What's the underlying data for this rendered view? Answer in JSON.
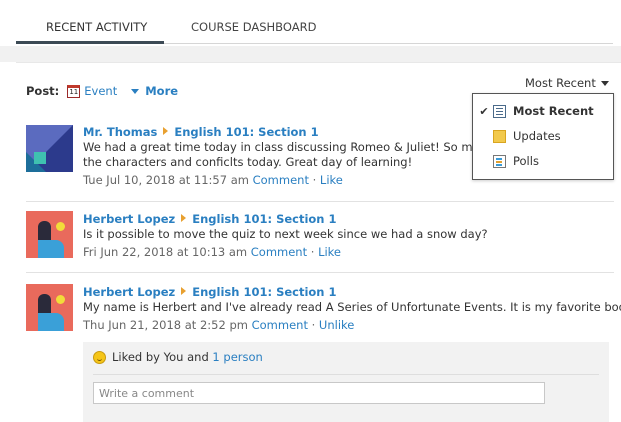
{
  "tabs": [
    {
      "label": "RECENT ACTIVITY",
      "active": true
    },
    {
      "label": "COURSE DASHBOARD",
      "active": false
    }
  ],
  "post_bar": {
    "label": "Post:",
    "calendar_day": "11",
    "event_label": "Event",
    "more_label": "More"
  },
  "sort": {
    "current": "Most Recent",
    "options": [
      {
        "label": "Most Recent",
        "selected": true,
        "icon": "list-icon"
      },
      {
        "label": "Updates",
        "selected": false,
        "icon": "updates-icon"
      },
      {
        "label": "Polls",
        "selected": false,
        "icon": "polls-icon"
      }
    ],
    "check": "✔"
  },
  "feed": [
    {
      "author": "Mr. Thomas",
      "course": "English 101: Section 1",
      "lines": [
        "We had a great time today in class discussing Romeo & Juliet! So many way",
        "the characters and conficlts today. Great day of learning!"
      ],
      "timestamp": "Tue Jul 10, 2018 at 11:57 am",
      "comment_label": "Comment",
      "like_label": "Like"
    },
    {
      "author": "Herbert Lopez",
      "course": "English 101: Section 1",
      "lines": [
        "Is it possible to move the quiz to next week since we had a snow day?"
      ],
      "timestamp": "Fri Jun 22, 2018 at 10:13 am",
      "comment_label": "Comment",
      "like_label": "Like"
    },
    {
      "author": "Herbert Lopez",
      "course": "English 101: Section 1",
      "lines": [
        "My name is Herbert and I've already read A Series of Unfortunate Events. It is my favorite book!"
      ],
      "timestamp": "Thu Jun 21, 2018 at 2:52 pm",
      "comment_label": "Comment",
      "like_label": "Unlike"
    }
  ],
  "likes": {
    "prefix": "Liked by You and",
    "others_link": "1 person"
  },
  "comment_box": {
    "placeholder": "Write a comment"
  },
  "separator": " · "
}
